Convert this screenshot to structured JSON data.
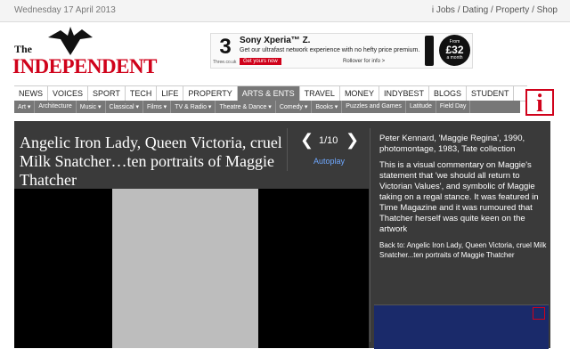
{
  "topbar": {
    "date": "Wednesday 17 April 2013",
    "links": "i Jobs / Dating / Property / Shop"
  },
  "logo": {
    "line1": "The",
    "line2": "INDEPENDENT"
  },
  "ad": {
    "brand": "3",
    "brand_url": "Three.co.uk",
    "headline": "Sony Xperia™ Z.",
    "subline": "Get our ultrafast network experience with no hefty price premium.",
    "cta": "Get yours now",
    "rollover": "Rollover for info >",
    "price_from": "From",
    "price": "£32",
    "price_per": "a month"
  },
  "nav": {
    "items": [
      "NEWS",
      "VOICES",
      "SPORT",
      "TECH",
      "LIFE",
      "PROPERTY",
      "ARTS & ENTS",
      "TRAVEL",
      "MONEY",
      "INDYBEST",
      "BLOGS",
      "STUDENT"
    ],
    "active_index": 6
  },
  "subnav": {
    "items": [
      "Art ▾",
      "Architecture",
      "Music ▾",
      "Classical ▾",
      "Films ▾",
      "TV & Radio ▾",
      "Theatre & Dance ▾",
      "Comedy ▾",
      "Books ▾",
      "Puzzles and Games",
      "Latitude",
      "Field Day"
    ]
  },
  "info_icon": "i",
  "gallery": {
    "title": "Angelic Iron Lady, Queen Victoria, cruel Milk Snatcher…ten portraits of Maggie Thatcher",
    "counter": "1/10",
    "autoplay": "Autoplay",
    "caption_line1": "Peter Kennard, 'Maggie Regina', 1990, photomontage, 1983, Tate collection",
    "caption_body": "This is a visual commentary on Maggie's statement that 'we should all return to Victorian Values', and symbolic of Maggie taking on a regal stance. It was featured in Time Magazine and it was rumoured that Thatcher herself was quite keen on the artwork",
    "back_link": "Back to: Angelic Iron Lady, Queen Victoria, cruel Milk Snatcher...ten portraits of Maggie Thatcher"
  }
}
